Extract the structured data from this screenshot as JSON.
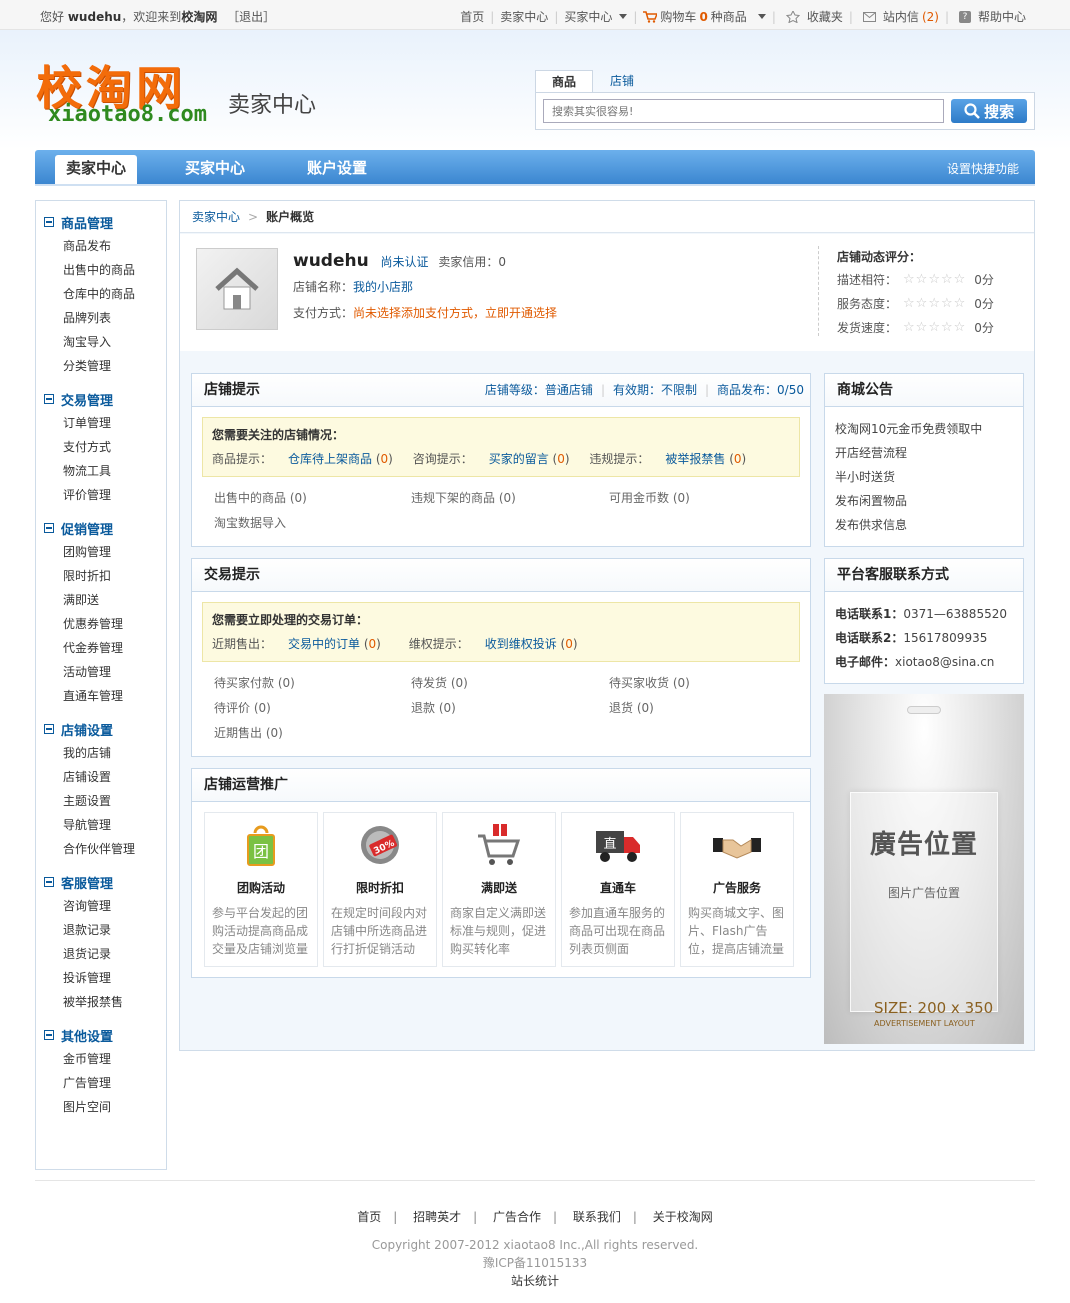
{
  "topbar": {
    "greeting_prefix": "您好",
    "username": "wudehu",
    "welcome": "，欢迎来到",
    "site": "校淘网",
    "logout": "［退出］",
    "links": {
      "home": "首页",
      "seller": "卖家中心",
      "buyer": "买家中心",
      "cart_prefix": "购物车",
      "cart_count": "0",
      "cart_suffix": "种商品",
      "favorites": "收藏夹",
      "messages": "站内信",
      "messages_count": "(2)",
      "help": "帮助中心"
    }
  },
  "header": {
    "logo_cn": "校淘网",
    "logo_en": "xiaotao8.com",
    "section": "卖家中心",
    "search": {
      "tab_goods": "商品",
      "tab_shop": "店铺",
      "placeholder": "搜索其实很容易!",
      "button": "搜索"
    }
  },
  "nav": {
    "items": [
      "卖家中心",
      "买家中心",
      "账户设置"
    ],
    "quick": "设置快捷功能"
  },
  "sidebar": {
    "groups": [
      {
        "title": "商品管理",
        "items": [
          "商品发布",
          "出售中的商品",
          "仓库中的商品",
          "品牌列表",
          "淘宝导入",
          "分类管理"
        ]
      },
      {
        "title": "交易管理",
        "items": [
          "订单管理",
          "支付方式",
          "物流工具",
          "评价管理"
        ]
      },
      {
        "title": "促销管理",
        "items": [
          "团购管理",
          "限时折扣",
          "满即送",
          "优惠券管理",
          "代金券管理",
          "活动管理",
          "直通车管理"
        ]
      },
      {
        "title": "店铺设置",
        "items": [
          "我的店铺",
          "店铺设置",
          "主题设置",
          "导航管理",
          "合作伙伴管理"
        ]
      },
      {
        "title": "客服管理",
        "items": [
          "咨询管理",
          "退款记录",
          "退货记录",
          "投诉管理",
          "被举报禁售"
        ]
      },
      {
        "title": "其他设置",
        "items": [
          "金币管理",
          "广告管理",
          "图片空间"
        ]
      }
    ]
  },
  "breadcrumb": {
    "root": "卖家中心",
    "current": "账户概览"
  },
  "profile": {
    "username": "wudehu",
    "verify": "尚未认证",
    "credit_label": "卖家信用：",
    "credit_value": "0",
    "shop_label": "店铺名称：",
    "shop_name": "我的小店那",
    "pay_label": "支付方式：",
    "pay_value": "尚未选择添加支付方式，立即开通选择",
    "rating_title": "店铺动态评分：",
    "ratings": [
      {
        "label": "描述相符：",
        "value": "0分"
      },
      {
        "label": "服务态度：",
        "value": "0分"
      },
      {
        "label": "发货速度：",
        "value": "0分"
      }
    ]
  },
  "shop_tips": {
    "title": "店铺提示",
    "level": "店铺等级：普通店铺",
    "validity": "有效期：不限制",
    "goods": "商品发布：0/50",
    "alert_title": "您需要关注的店铺情况：",
    "alerts": [
      {
        "label": "商品提示：",
        "link": "仓库待上架商品",
        "count": "0"
      },
      {
        "label": "咨询提示：",
        "link": "买家的留言",
        "count": "0"
      },
      {
        "label": "违规提示：",
        "link": "被举报禁售",
        "count": "0"
      }
    ],
    "stats": [
      "出售中的商品 (0)",
      "违规下架的商品 (0)",
      "可用金币数 (0)",
      "淘宝数据导入"
    ]
  },
  "trade_tips": {
    "title": "交易提示",
    "alert_title": "您需要立即处理的交易订单：",
    "alerts": [
      {
        "label": "近期售出：",
        "link": "交易中的订单",
        "count": "0"
      },
      {
        "label": "维权提示：",
        "link": "收到维权投诉",
        "count": "0"
      }
    ],
    "stats": [
      "待买家付款 (0)",
      "待发货 (0)",
      "待买家收货 (0)",
      "待评价 (0)",
      "退款 (0)",
      "退货 (0)",
      "近期售出 (0)"
    ]
  },
  "promotion": {
    "title": "店铺运营推广",
    "items": [
      {
        "name": "团购活动",
        "desc": "参与平台发起的团购活动提高商品成交量及店铺浏览量",
        "icon": "group-buy-icon"
      },
      {
        "name": "限时折扣",
        "desc": "在规定时间段内对店铺中所选商品进行打折促销活动",
        "icon": "discount-icon",
        "badge": "30%"
      },
      {
        "name": "满即送",
        "desc": "商家自定义满即送标准与规则，促进购买转化率",
        "icon": "cart-gift-icon"
      },
      {
        "name": "直通车",
        "desc": "参加直通车服务的商品可出现在商品列表页侧面",
        "icon": "truck-icon",
        "badge": "直"
      },
      {
        "name": "广告服务",
        "desc": "购买商城文字、图片、Flash广告位，提高店铺流量",
        "icon": "handshake-icon"
      }
    ]
  },
  "announcements": {
    "title": "商城公告",
    "items": [
      "校淘网10元金币免费领取中",
      "开店经营流程",
      "半小时送货",
      "发布闲置物品",
      "发布供求信息"
    ]
  },
  "contact": {
    "title": "平台客服联系方式",
    "items": [
      {
        "label": "电话联系1：",
        "value": "0371—63885520"
      },
      {
        "label": "电话联系2：",
        "value": "15617809935"
      },
      {
        "label": "电子邮件：",
        "value": "xiotao8@sina.cn"
      }
    ]
  },
  "ad": {
    "title": "廣告位置",
    "subtitle": "图片广告位置",
    "size": "SIZE: 200 x 350",
    "layout": "ADVERTISEMENT LAYOUT"
  },
  "footer": {
    "links": [
      "首页",
      "招聘英才",
      "广告合作",
      "联系我们",
      "关于校淘网"
    ],
    "copyright": "Copyright 2007-2012 xiaotao8 Inc.,All rights reserved.",
    "icp": "豫ICP备11015133",
    "stats": "站长统计"
  },
  "colors": {
    "brand_orange": "#f36c0a",
    "brand_green": "#2f8a1f",
    "nav_blue": "#3b86d0",
    "link_blue": "#0a5a9c"
  }
}
